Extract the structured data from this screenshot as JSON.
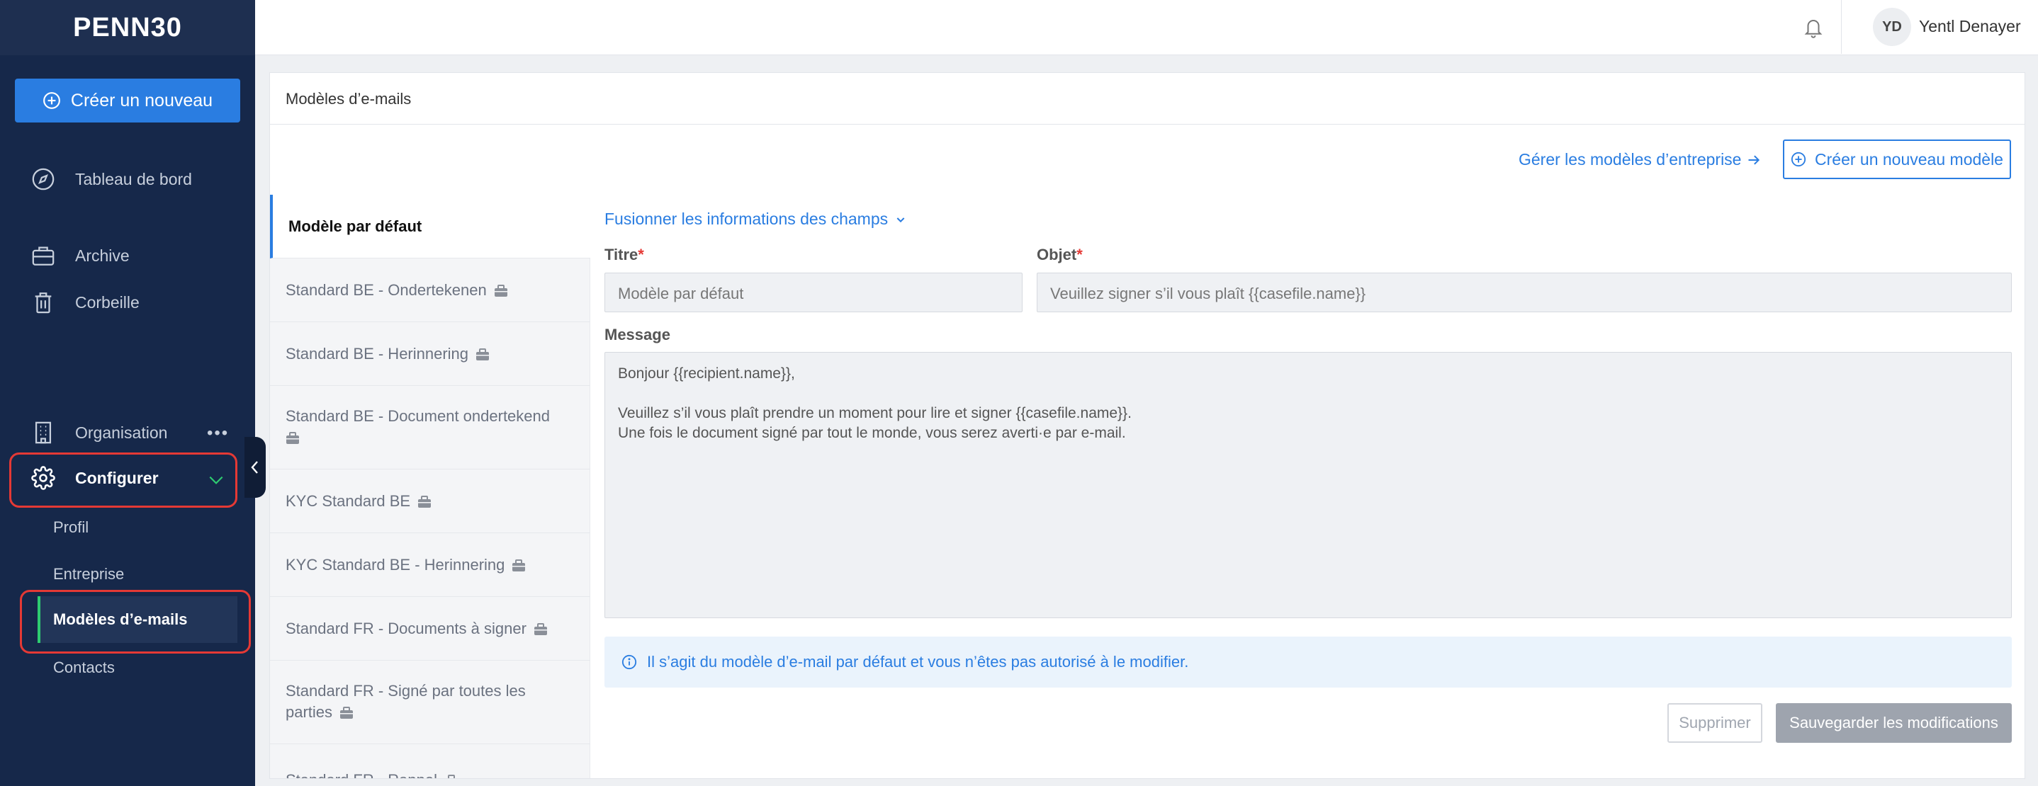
{
  "app": {
    "logo_text": "PENN30"
  },
  "sidebar": {
    "create_label": "Créer un nouveau",
    "dashboard": "Tableau de bord",
    "archive": "Archive",
    "trash": "Corbeille",
    "organisation": "Organisation",
    "organisation_more": "•••",
    "configure": "Configurer",
    "sub_items": {
      "profile": "Profil",
      "company": "Entreprise",
      "email_templates": "Modèles d’e-mails",
      "contacts": "Contacts"
    }
  },
  "header": {
    "avatar_initials": "YD",
    "user_name": "Yentl Denayer"
  },
  "page": {
    "title": "Modèles d’e-mails",
    "manage_link": "Gérer les modèles d’entreprise",
    "new_template_label": "Créer un nouveau modèle"
  },
  "templates": [
    {
      "name": "Modèle par défaut",
      "company": false,
      "active": true
    },
    {
      "name": "Standard BE - Ondertekenen",
      "company": true
    },
    {
      "name": "Standard BE - Herinnering",
      "company": true
    },
    {
      "name": "Standard BE - Document ondertekend",
      "company": true
    },
    {
      "name": "KYC Standard BE",
      "company": true
    },
    {
      "name": "KYC Standard BE - Herinnering",
      "company": true
    },
    {
      "name": "Standard FR - Documents à signer",
      "company": true
    },
    {
      "name": "Standard FR - Signé par toutes les parties",
      "company": true
    },
    {
      "name": "Standard FR - Rappel",
      "company": true
    }
  ],
  "form": {
    "merge_fields_label": "Fusionner les informations des champs",
    "title_label": "Titre",
    "title_value": "Modèle par défaut",
    "subject_label": "Objet",
    "subject_value": "Veuillez signer s’il vous plaît {{casefile.name}}",
    "required_mark": "*",
    "message_label": "Message",
    "message_value": "Bonjour {{recipient.name}},\n\nVeuillez s’il vous plaît prendre un moment pour lire et signer {{casefile.name}}.\nUne fois le document signé par tout le monde, vous serez averti·e par e-mail.",
    "info_text": "Il s’agit du modèle d’e-mail par défaut et vous n’êtes pas autorisé à le modifier.",
    "delete_label": "Supprimer",
    "save_label": "Sauvegarder les modifications"
  },
  "colors": {
    "sidebar_bg": "#16284a",
    "accent": "#2a7de1",
    "highlight_ring": "#e53935",
    "active_marker": "#2ecc71"
  }
}
